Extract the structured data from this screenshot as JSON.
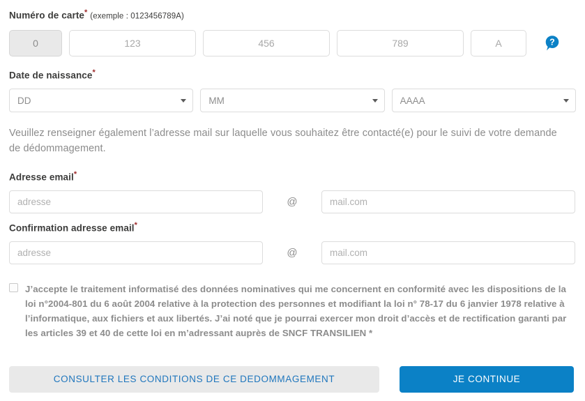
{
  "card_number": {
    "label": "Numéro de carte",
    "required_mark": "*",
    "hint": "(exemple : 0123456789A)",
    "inputs": [
      {
        "name": "card-segment-0",
        "value": "0",
        "placeholder": "0",
        "disabled": true
      },
      {
        "name": "card-segment-1",
        "value": "",
        "placeholder": "123",
        "disabled": false
      },
      {
        "name": "card-segment-2",
        "value": "",
        "placeholder": "456",
        "disabled": false
      },
      {
        "name": "card-segment-3",
        "value": "",
        "placeholder": "789",
        "disabled": false
      },
      {
        "name": "card-segment-4",
        "value": "",
        "placeholder": "A",
        "disabled": false
      }
    ],
    "help_icon": "help-question-bubble-icon",
    "help_color": "#0b81c6"
  },
  "birth_date": {
    "label": "Date de naissance",
    "required_mark": "*",
    "day": {
      "selected": "DD",
      "options": [
        "DD"
      ]
    },
    "month": {
      "selected": "MM",
      "options": [
        "MM"
      ]
    },
    "year": {
      "selected": "AAAA",
      "options": [
        "AAAA"
      ]
    }
  },
  "intro_text": "Veuillez renseigner également l’adresse mail sur laquelle vous souhaitez être contacté(e) pour le suivi de votre demande de dédommagement.",
  "email": {
    "label": "Adresse email",
    "required_mark": "*",
    "local_placeholder": "adresse",
    "local_value": "",
    "at_symbol": "@",
    "domain_placeholder": "mail.com",
    "domain_value": ""
  },
  "email_confirm": {
    "label": "Confirmation adresse email",
    "required_mark": "*",
    "local_placeholder": "adresse",
    "local_value": "",
    "at_symbol": "@",
    "domain_placeholder": "mail.com",
    "domain_value": ""
  },
  "consent": {
    "checked": false,
    "text": "J’accepte le traitement informatisé des données nominatives qui me concernent en conformité avec les dispositions de la loi n°2004-801 du 6 août 2004 relative à la protection des personnes et modifiant la loi n° 78-17 du 6 janvier 1978 relative à l’informatique, aux fichiers et aux libertés. J’ai noté que je pourrai exercer mon droit d’accès et de rectification garanti par les articles 39 et 40 de cette loi en m’adressant auprès de SNCF TRANSILIEN",
    "required_mark": "*"
  },
  "actions": {
    "secondary_label": "CONSULTER LES CONDITIONS DE CE DEDOMMAGEMENT",
    "secondary_color": "#1f76bd",
    "secondary_bg": "#e9e9e9",
    "primary_label": "JE CONTINUE",
    "primary_bg": "#0b81c6",
    "primary_color": "#ffffff"
  }
}
